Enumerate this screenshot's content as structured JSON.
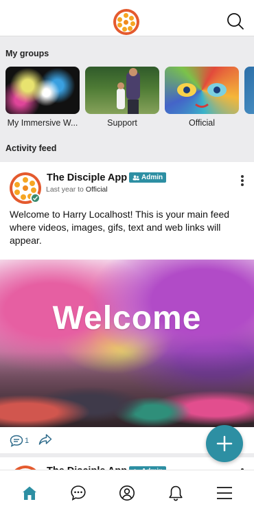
{
  "header": {
    "logo": "disciple-logo",
    "search_icon": "search-icon"
  },
  "groups": {
    "title": "My groups",
    "items": [
      {
        "label": "My Immersive W..."
      },
      {
        "label": "Support"
      },
      {
        "label": "Official"
      },
      {
        "label": ""
      }
    ]
  },
  "feed": {
    "title": "Activity feed",
    "post": {
      "author": "The Disciple App",
      "badge": "Admin",
      "time": "Last year",
      "to_word": "to",
      "group": "Official",
      "text": "Welcome to Harry Localhost! This is your main feed where videos, images, gifs, text and web links will appear.",
      "image_text": "Welcome",
      "comment_count": "1"
    },
    "next_post": {
      "author": "The Disciple App",
      "badge": "Admin"
    }
  },
  "fab_icon": "plus-icon",
  "tabs": [
    {
      "name": "home",
      "icon": "home-icon"
    },
    {
      "name": "chat",
      "icon": "chat-icon"
    },
    {
      "name": "profile",
      "icon": "profile-icon"
    },
    {
      "name": "notifications",
      "icon": "bell-icon"
    },
    {
      "name": "menu",
      "icon": "menu-icon"
    }
  ],
  "colors": {
    "accent": "#2d8fa3",
    "logo_orange": "#e45a2e",
    "logo_yellow": "#f6a623",
    "home_active": "#2d8fa3"
  }
}
